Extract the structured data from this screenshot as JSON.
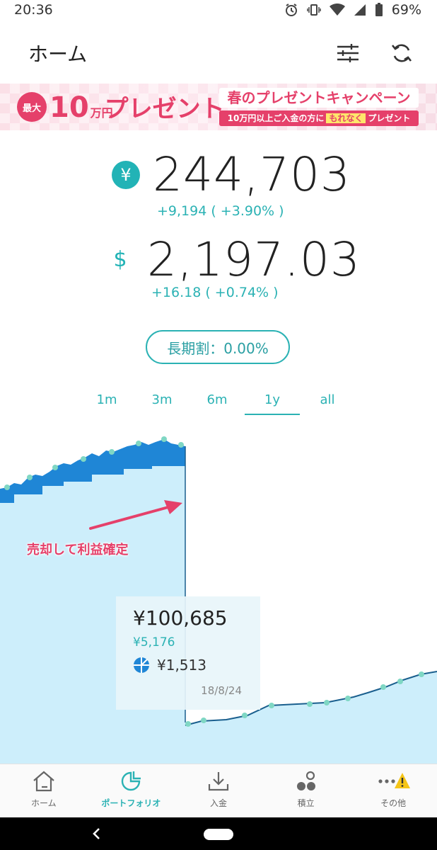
{
  "status_bar": {
    "time": "20:36",
    "battery": "69%"
  },
  "header": {
    "title": "ホーム",
    "icons": [
      "sliders-icon",
      "refresh-icon"
    ]
  },
  "banner": {
    "badge": "最大",
    "amount": "10",
    "unit": "万円",
    "headline": "プレゼント",
    "campaign": "春のプレゼントキャンペーン",
    "sub_prefix": "10万円以上ご入金の方に",
    "sub_highlight": "もれなく",
    "sub_suffix": "プレゼント"
  },
  "balances": {
    "jpy": {
      "value": "244,703",
      "change": "+9,194 ( +3.90% )",
      "symbol": "¥"
    },
    "usd": {
      "value": "2,197.03",
      "change": "+16.18 ( +0.74% )",
      "symbol": "$"
    }
  },
  "long_term": {
    "label": "長期割：0.00%"
  },
  "range_tabs": [
    {
      "label": "1m"
    },
    {
      "label": "3m"
    },
    {
      "label": "6m"
    },
    {
      "label": "1y",
      "active": true
    },
    {
      "label": "all"
    }
  ],
  "chart": {
    "annotation": "売却して利益確定",
    "tooltip": {
      "value": "¥100,685",
      "sub": "¥5,176",
      "dividend": "¥1,513",
      "date": "18/8/24"
    },
    "colors": {
      "fill": "#cdeefb",
      "gain": "#1f86d6",
      "line": "#1a5f8e",
      "dot": "#7fd7c4",
      "arrow": "#e5406a"
    }
  },
  "bottom_nav": [
    {
      "label": "ホーム",
      "icon": "home-icon"
    },
    {
      "label": "ポートフォリオ",
      "icon": "portfolio-icon",
      "active": true
    },
    {
      "label": "入金",
      "icon": "deposit-icon"
    },
    {
      "label": "積立",
      "icon": "savings-icon"
    },
    {
      "label": "その他",
      "icon": "more-icon"
    }
  ]
}
